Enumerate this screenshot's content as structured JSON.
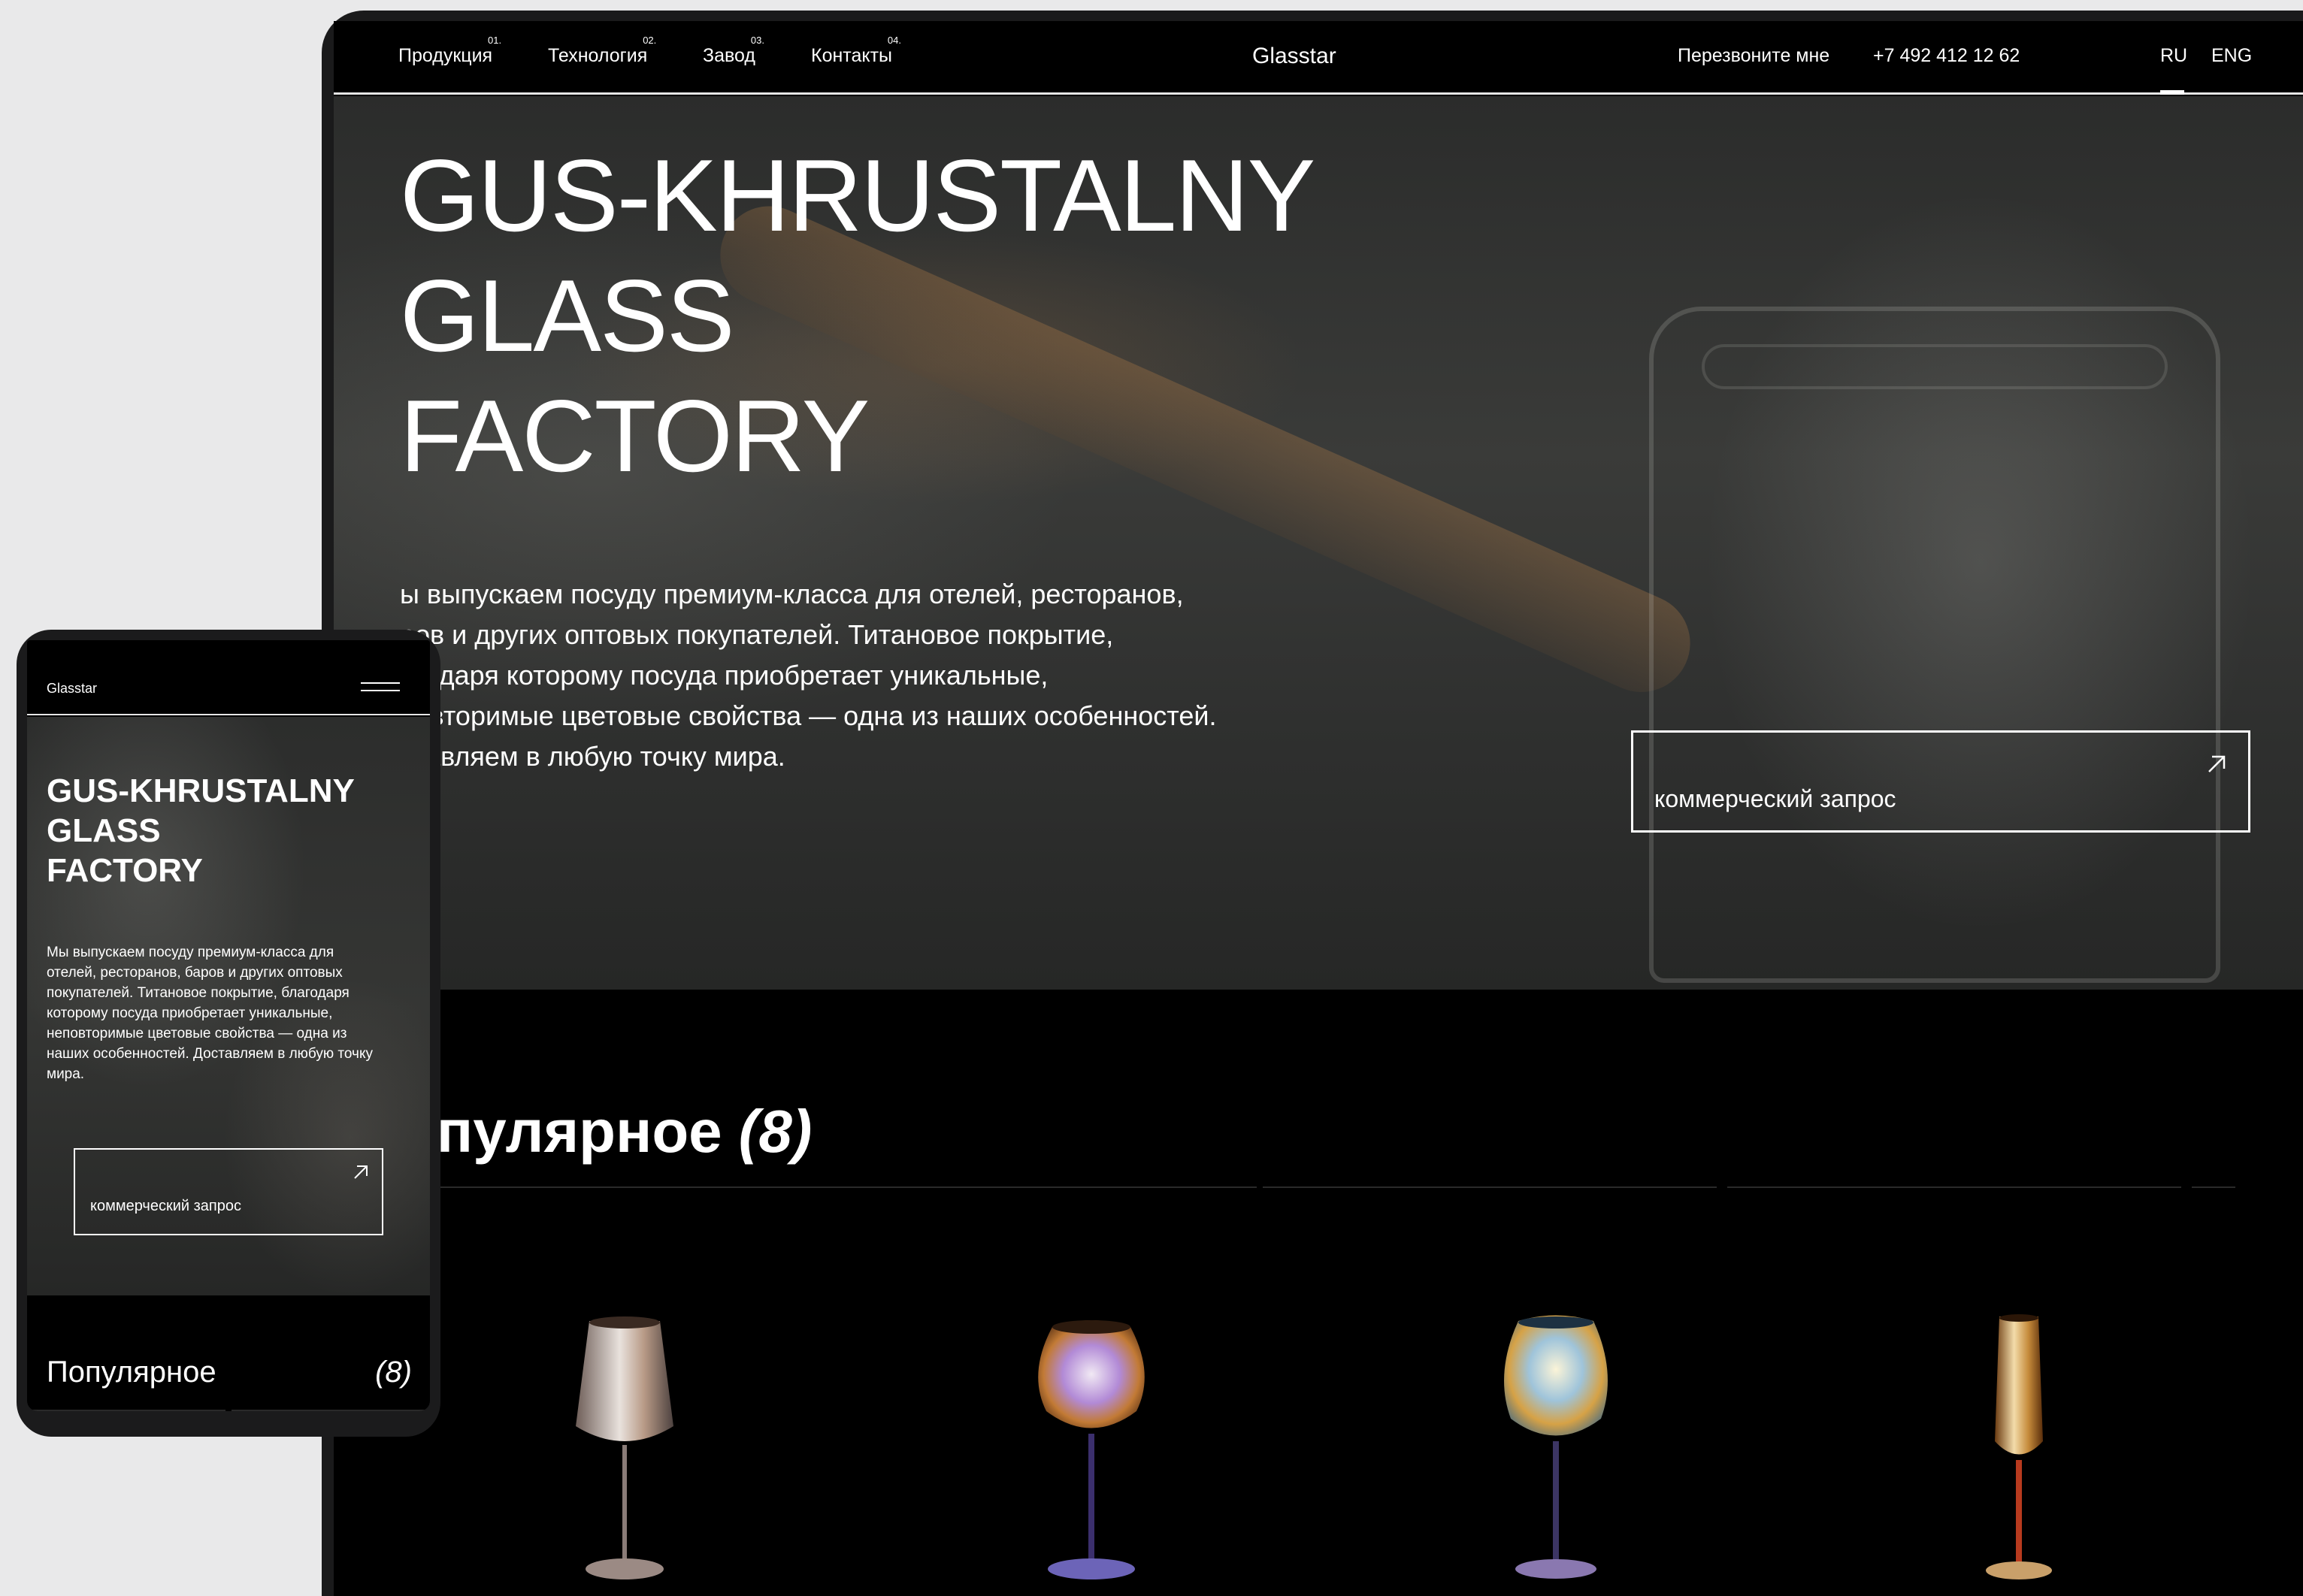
{
  "desktop": {
    "nav": {
      "items": [
        {
          "label": "Продукция",
          "num": "01."
        },
        {
          "label": "Технология",
          "num": "02."
        },
        {
          "label": "Завод",
          "num": "03."
        },
        {
          "label": "Контакты",
          "num": "04."
        }
      ],
      "logo": "Glasstar",
      "callback": "Перезвоните мне",
      "phone": "+7 492 412 12 62",
      "languages": [
        "RU",
        "ENG"
      ],
      "active_language": "RU"
    },
    "hero": {
      "title_lines": [
        "GUS-KHRUSTALNY",
        "GLASS",
        "FACTORY"
      ],
      "description_lines": [
        "ы выпускаем посуду премиум-класса для отелей, ресторанов,",
        "ров и других оптовых покупателей. Титановое покрытие,",
        "агодаря которому посуда приобретает уникальные,",
        "повторимые цветовые свойства — одна из наших особенностей.",
        "ставляем в любую точку мира."
      ],
      "cta_label": "коммерческий запрос"
    },
    "popular": {
      "title": "опулярное",
      "count": "(8)"
    }
  },
  "mobile": {
    "nav": {
      "logo": "Glasstar"
    },
    "hero": {
      "title_lines": [
        "GUS-KHRUSTALNY",
        "GLASS",
        "FACTORY"
      ],
      "description_lines": [
        "Мы выпускаем посуду премиум-класса для",
        "отелей, ресторанов, баров и других оптовых",
        "покупателей. Титановое покрытие, благодаря",
        "которому посуда приобретает уникальные,",
        "неповторимые цветовые свойства — одна из",
        "наших особенностей. Доставляем в любую точку",
        "мира."
      ],
      "cta_label": "коммерческий запрос"
    },
    "popular": {
      "title": "Популярное",
      "count": "(8)"
    }
  },
  "icons": {
    "cta_arrow": "arrow-up-right-icon",
    "menu": "hamburger-menu-icon",
    "products": [
      "wine-glass",
      "brandy-snifter-glass",
      "wine-glass",
      "champagne-flute"
    ]
  },
  "colors": {
    "background": "#000000",
    "text": "#ffffff",
    "page": "#e9e9ea",
    "frame": "#1a1a1b"
  }
}
